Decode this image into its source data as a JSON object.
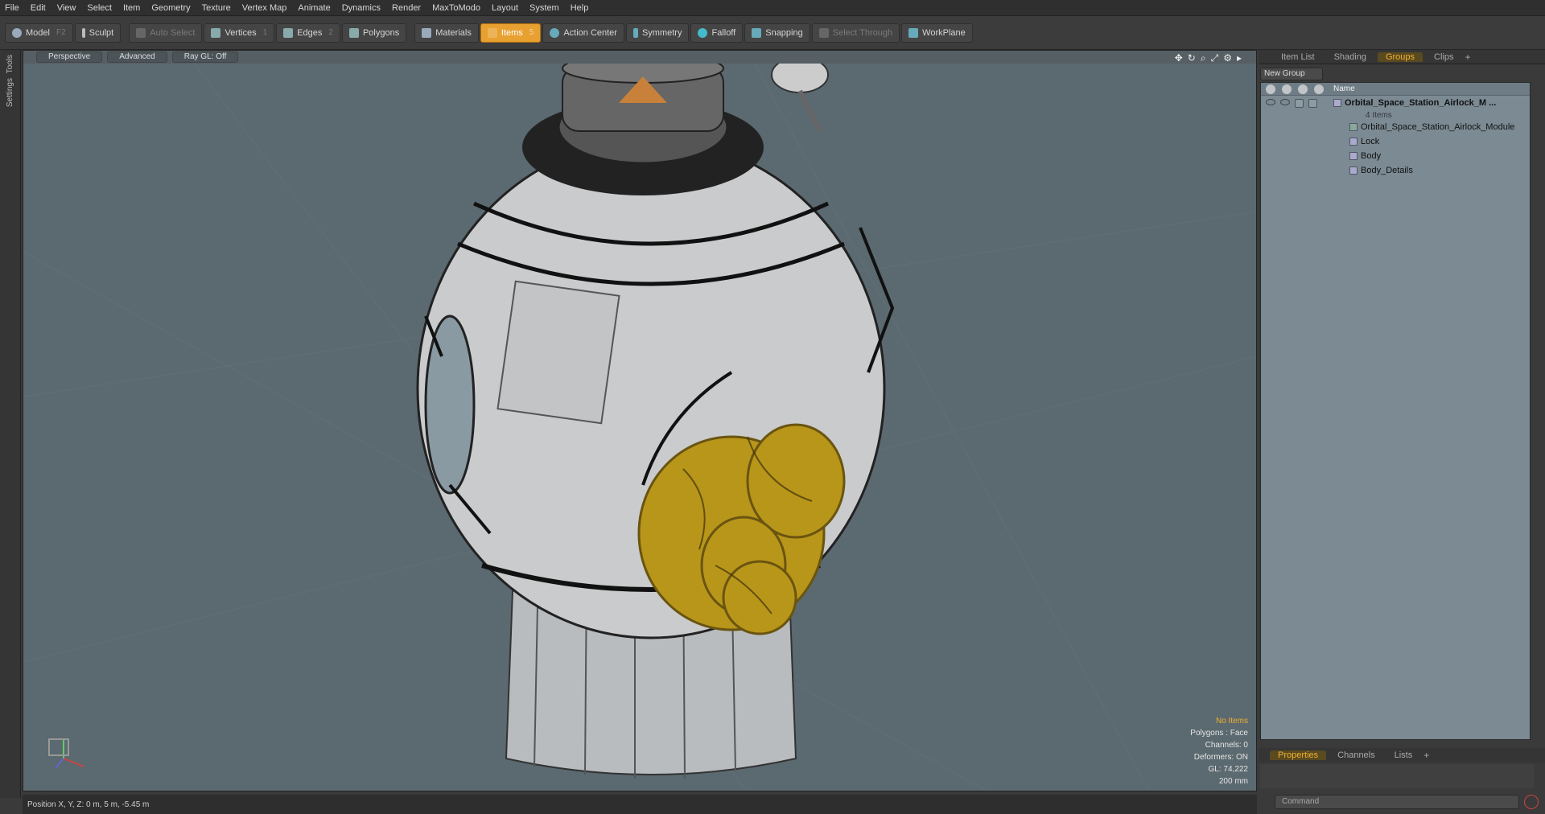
{
  "menu": [
    "File",
    "Edit",
    "View",
    "Select",
    "Item",
    "Geometry",
    "Texture",
    "Vertex Map",
    "Animate",
    "Dynamics",
    "Render",
    "MaxToModo",
    "Layout",
    "System",
    "Help"
  ],
  "toolbar": {
    "model": "Model",
    "model_key": "F2",
    "sculpt": "Sculpt",
    "auto_select": "Auto Select",
    "vertices": "Vertices",
    "vertices_key": "1",
    "edges": "Edges",
    "edges_key": "2",
    "polygons": "Polygons",
    "materials": "Materials",
    "items": "Items",
    "items_key": "5",
    "action_center": "Action Center",
    "symmetry": "Symmetry",
    "falloff": "Falloff",
    "snapping": "Snapping",
    "select_through": "Select Through",
    "workplane": "WorkPlane"
  },
  "left_rail": {
    "tools": "Tools",
    "settings": "Settings"
  },
  "viewport": {
    "perspective": "Perspective",
    "advanced": "Advanced",
    "raygl": "Ray GL: Off",
    "info": {
      "no_items": "No Items",
      "polygons": "Polygons : Face",
      "channels": "Channels: 0",
      "deformers": "Deformers: ON",
      "gl": "GL: 74,222",
      "scale": "200 mm"
    }
  },
  "status": {
    "position": "Position X, Y, Z:  0 m, 5 m, -5.45 m"
  },
  "right_panel": {
    "tabs": [
      "Item List",
      "Shading",
      "Groups",
      "Clips"
    ],
    "new_group": "New Group",
    "name_col": "Name",
    "tree": [
      {
        "label": "Orbital_Space_Station_Airlock_M ...",
        "sub": "4 Items"
      },
      {
        "label": "Orbital_Space_Station_Airlock_Module"
      },
      {
        "label": "Lock"
      },
      {
        "label": "Body"
      },
      {
        "label": "Body_Details"
      }
    ],
    "bottom_tabs": [
      "Properties",
      "Channels",
      "Lists"
    ],
    "command_placeholder": "Command"
  },
  "colors": {
    "accent": "#e8a030",
    "viewport_bg": "#5b6970",
    "gold": "#b8961a"
  }
}
